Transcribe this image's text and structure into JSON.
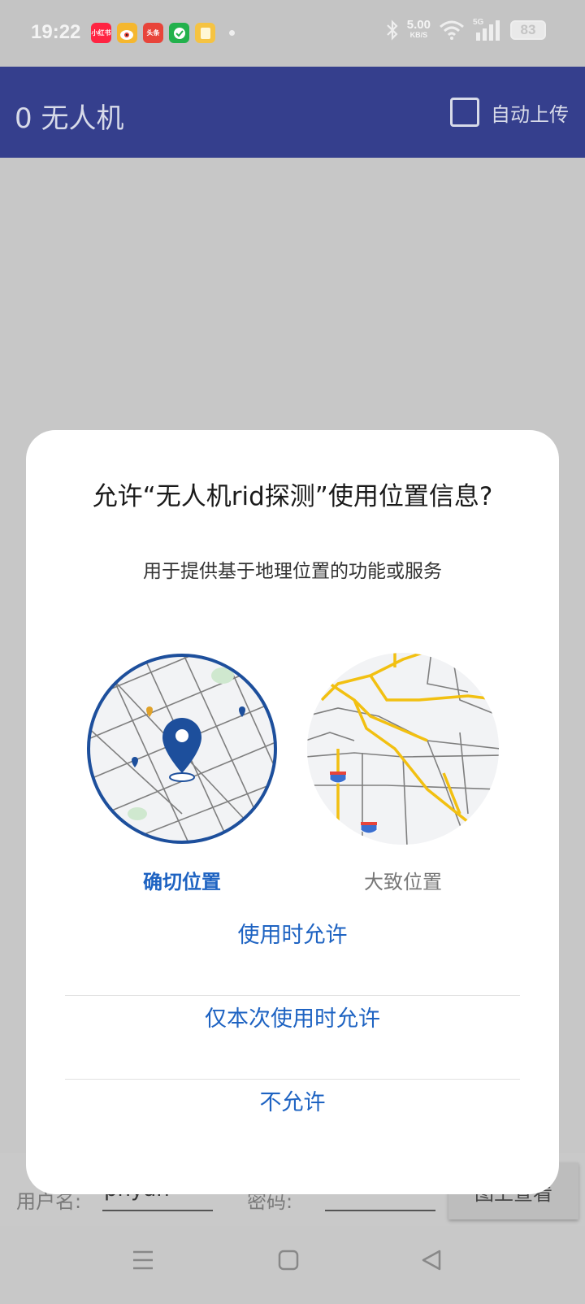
{
  "status_bar": {
    "time": "19:22",
    "apps": [
      {
        "icon": "xiaohongshu-icon",
        "text": "小红书",
        "color": "#ff2442"
      },
      {
        "icon": "weibo-icon",
        "text": "",
        "color": "#f5b72f"
      },
      {
        "icon": "toutiao-icon",
        "text": "头条",
        "color": "#e8443a"
      },
      {
        "icon": "wechat-like-icon",
        "text": "",
        "color": "#22b14c"
      },
      {
        "icon": "notes-icon",
        "text": "",
        "color": "#f5c342"
      }
    ],
    "net_speed": "5.00",
    "net_unit": "KB/S",
    "signal_label": "5G",
    "battery": "83"
  },
  "app_bar": {
    "title": "0 无人机",
    "auto_upload_label": "自动上传",
    "color": "#353f8d"
  },
  "login_row": {
    "username_label": "用户名:",
    "username_value": "phyan",
    "password_label": "密码:",
    "map_button_label": "图上查看"
  },
  "dialog": {
    "title": "允许“无人机rid探测”使用位置信息?",
    "subtitle": "用于提供基于地理位置的功能或服务",
    "precise_label": "确切位置",
    "approximate_label": "大致位置",
    "actions": [
      "使用时允许",
      "仅本次使用时允许",
      "不允许"
    ],
    "accent_color": "#1e63c2"
  }
}
